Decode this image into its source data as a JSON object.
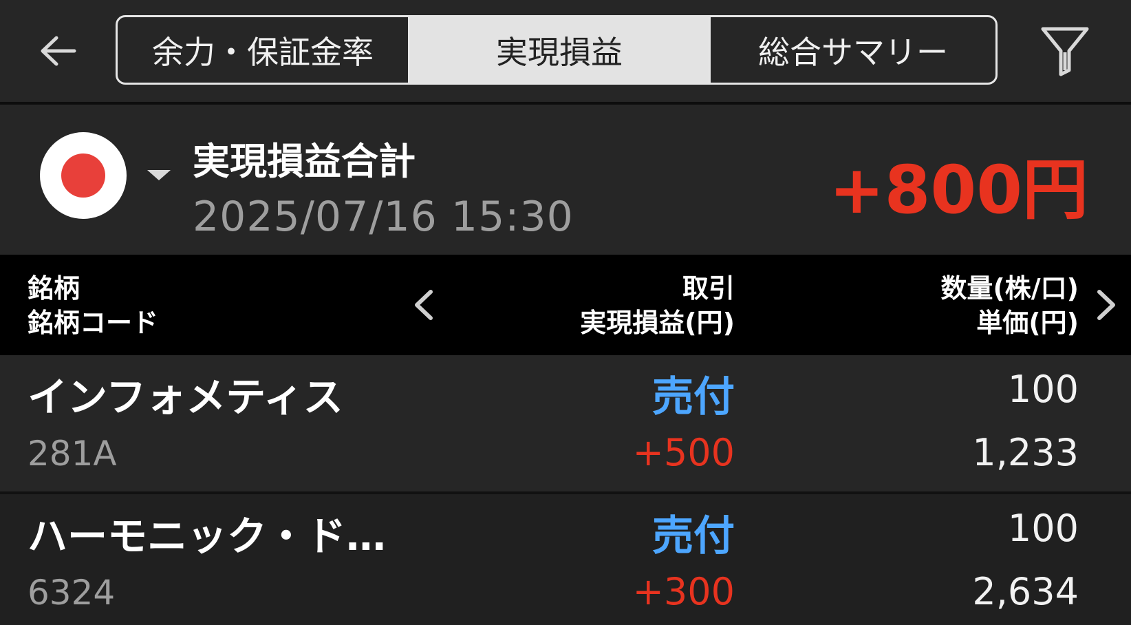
{
  "header": {
    "tabs": [
      {
        "label": "余力・保証金率"
      },
      {
        "label": "実現損益"
      },
      {
        "label": "総合サマリー"
      }
    ],
    "icons": {
      "back": "arrow-left-icon",
      "filter": "filter-icon"
    }
  },
  "summary": {
    "title": "実現損益合計",
    "datetime": "2025/07/16  15:30",
    "total": "+800円"
  },
  "table": {
    "header": {
      "col1_line1": "銘柄",
      "col1_line2": "銘柄コード",
      "col2_line1": "取引",
      "col2_line2": "実現損益(円)",
      "col3_line1": "数量(株/口)",
      "col3_line2": "単価(円)"
    },
    "rows": [
      {
        "name": "インフォメティス",
        "code": "281A",
        "trade": "売付",
        "pnl": "+500",
        "qty": "100",
        "price": "1,233"
      },
      {
        "name": "ハーモニック・ド…",
        "code": "6324",
        "trade": "売付",
        "pnl": "+300",
        "qty": "100",
        "price": "2,634"
      }
    ]
  },
  "colors": {
    "background": "#262626",
    "positive": "#e8331f",
    "trade_sell": "#4da6ff",
    "muted": "#9e9e9e",
    "flag_red": "#e8403a"
  }
}
